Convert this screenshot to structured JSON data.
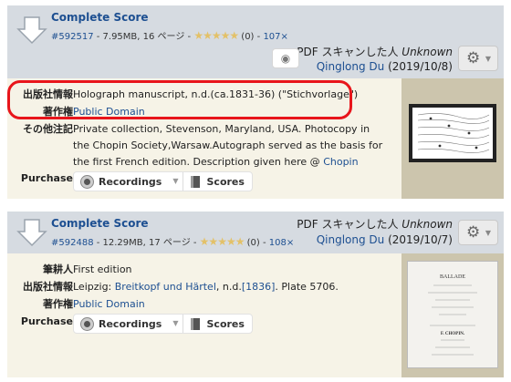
{
  "score1": {
    "title": "Complete Score",
    "id": "#592517",
    "meta_text": " - 7.95MB, 16 ページ - ",
    "rating_text": "(0) - ",
    "downloads": "107×",
    "dl_icon": "download-icon",
    "scan_type": "PDF スキャンした人 ",
    "scanner": "Unknown",
    "uploader": "Qinglong Du",
    "date": "(2019/10/8)",
    "publisher_label": "出版社情報",
    "publisher_value": "Holograph manuscript, n.d.(ca.1831-36) (\"Stichvorlage\")",
    "copyright_label": "著作権",
    "copyright_value": "Public Domain",
    "misc_label": "その他注記",
    "misc_value": "Private collection, Stevenson, Maryland, USA. Photocopy in the Chopin Society,Warsaw.Autograph served as the basis for the first French edition. Description given here @ ",
    "misc_link": "Chopin Society",
    "misc_end": ".",
    "purchase_label": "Purchase",
    "recordings_label": "Recordings",
    "scores_label": "Scores"
  },
  "score2": {
    "title": "Complete Score",
    "id": "#592488",
    "meta_text": " - 12.29MB, 17 ページ - ",
    "rating_text": "(0) - ",
    "downloads": "108×",
    "scan_type": "PDF スキャンした人 ",
    "scanner": "Unknown",
    "uploader": "Qinglong Du",
    "date": "(2019/10/7)",
    "editor_label": "筆耕人",
    "editor_value": "First edition",
    "publisher_label": "出版社情報",
    "publisher_pre": "Leipzig: ",
    "publisher_link": "Breitkopf und Härtel",
    "publisher_mid": ", n.d.",
    "publisher_year": "[1836]",
    "publisher_end": ". Plate 5706.",
    "copyright_label": "著作権",
    "copyright_value": "Public Domain",
    "purchase_label": "Purchase",
    "recordings_label": "Recordings",
    "scores_label": "Scores",
    "thumb_title": "BALLADE",
    "thumb_composer": "F. CHOPIN."
  },
  "stars": "★★★★★",
  "colors": {
    "accent": "#1d4f91",
    "highlight": "#e8151b",
    "header_bg": "#d6dbe1",
    "body_bg": "#f6f3e7"
  }
}
